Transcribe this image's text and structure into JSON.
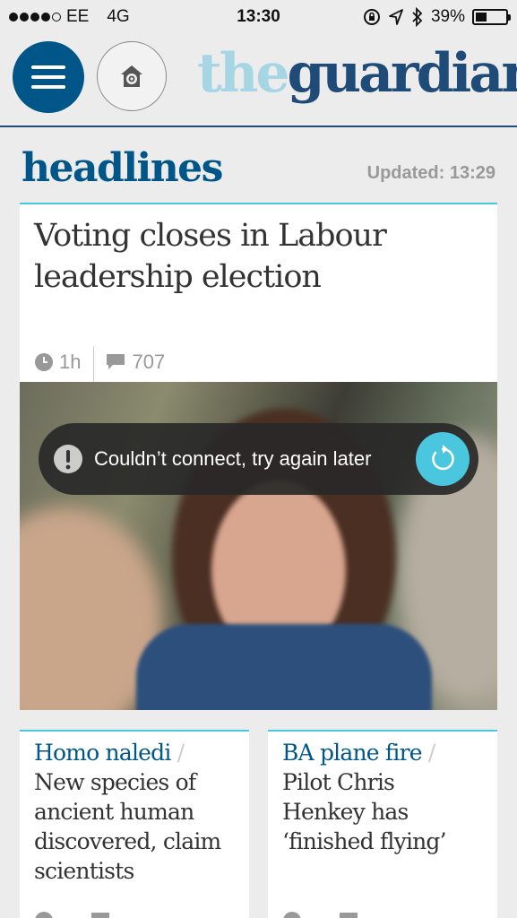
{
  "status_bar": {
    "carrier": "EE",
    "network": "4G",
    "time": "13:30",
    "battery": "39%",
    "battery_level": 0.39
  },
  "header": {
    "menu_icon": "hamburger-icon",
    "home_icon": "home-gear-icon",
    "logo_part1": "the",
    "logo_part2": "guardian"
  },
  "section": {
    "title": "headlines",
    "updated": "Updated: 13:29"
  },
  "main_story": {
    "headline": "Voting closes in Labour leadership election",
    "age": "1h",
    "comments": "707"
  },
  "toast": {
    "message": "Couldn’t connect, try again later",
    "icon": "exclamation-icon",
    "retry_icon": "refresh-icon"
  },
  "stories": [
    {
      "kicker": "Homo naledi",
      "headline": "New species of ancient human discovered, claim scientists"
    },
    {
      "kicker": "BA plane fire",
      "headline": "Pilot Chris Henkey has ‘finished flying’"
    }
  ],
  "colors": {
    "brand_blue": "#005689",
    "logo_light": "#a6d6e3",
    "accent_cyan": "#4bc6df"
  }
}
